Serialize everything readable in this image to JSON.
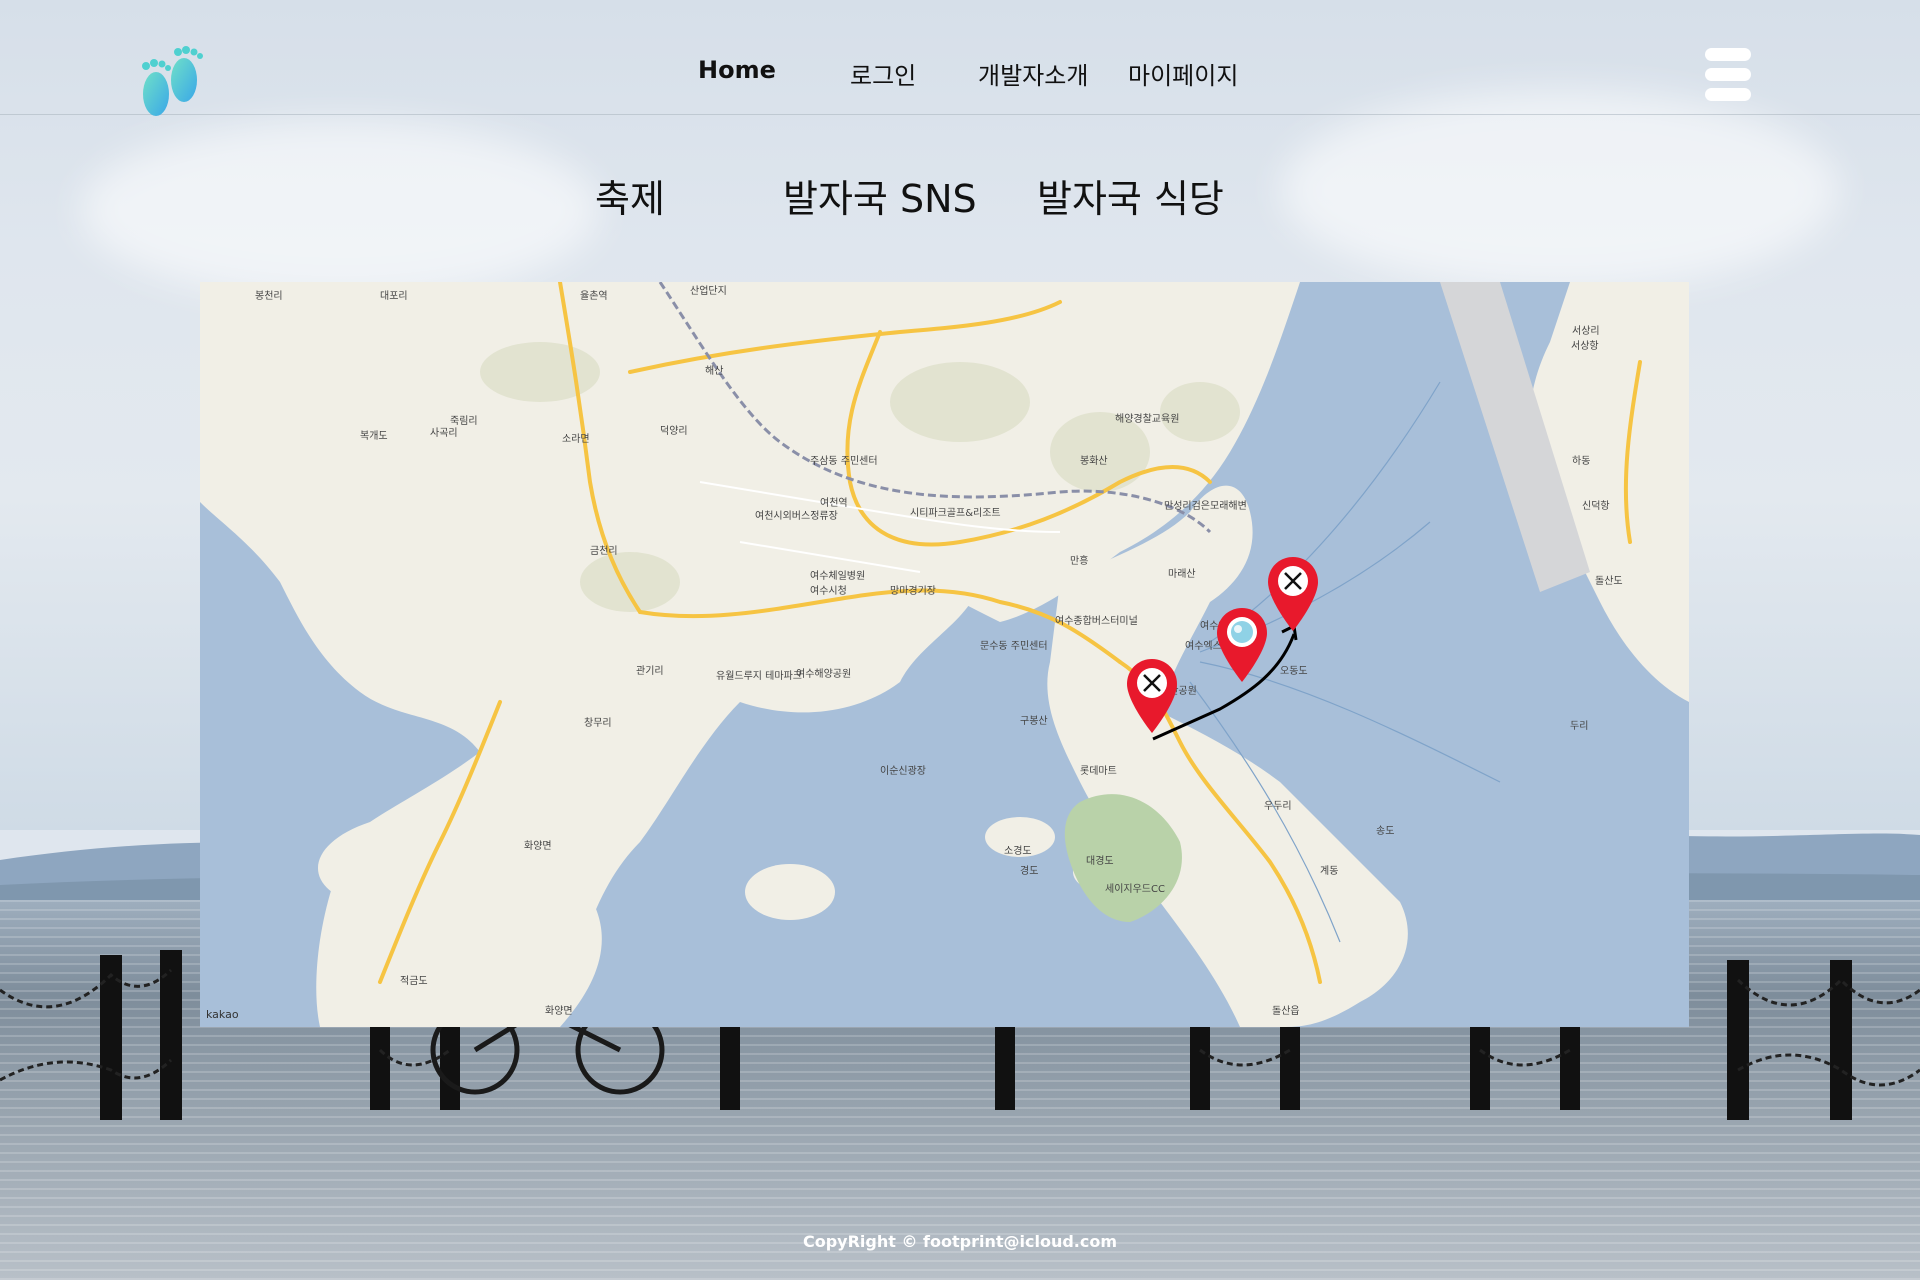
{
  "nav": {
    "home": "Home",
    "login": "로그인",
    "developers": "개발자소개",
    "mypage": "마이페이지"
  },
  "tabs": {
    "festival": "축제",
    "sns": "발자국 SNS",
    "restaurant": "발자국 식당"
  },
  "map": {
    "attribution": "kakao",
    "labels": [
      "봉천리",
      "대포리",
      "산업단지",
      "율촌역",
      "해산",
      "덕양리",
      "소라면",
      "죽림리",
      "복개도",
      "사곡리",
      "주삼동 주민센터",
      "여천역",
      "여천시외버스정류장",
      "여수시청",
      "여수체일병원",
      "망마경기장",
      "시티파크골프&리조트",
      "봉화산",
      "해양경찰교육원",
      "만흥",
      "마래산",
      "여수종합버스터미널",
      "문수동 주민센터",
      "화양면",
      "여수엑스포역",
      "오동도",
      "돌산공원",
      "구봉산",
      "롯데마트",
      "소경도",
      "대경도",
      "세이지우드CC",
      "우두리",
      "금천리",
      "관기리",
      "창무리",
      "유월드루지 테마파크",
      "여수해양공원",
      "이순신광장",
      "돌산읍",
      "화양면",
      "적금도",
      "송도",
      "신덕항",
      "돌산도",
      "두리",
      "계동",
      "서상리",
      "서상항",
      "하동",
      "만성리검은모래해변",
      "여수엑스포",
      "경도"
    ],
    "pins": [
      {
        "icon": "restaurant-icon"
      },
      {
        "icon": "sns-photo-icon"
      },
      {
        "icon": "restaurant-icon"
      }
    ]
  },
  "footer": {
    "copyright": "CopyRight © footprint@icloud.com"
  },
  "colors": {
    "pin": "#e8192c",
    "sea": "#a8bfd9",
    "land": "#f1efe6",
    "road": "#f6c443"
  }
}
